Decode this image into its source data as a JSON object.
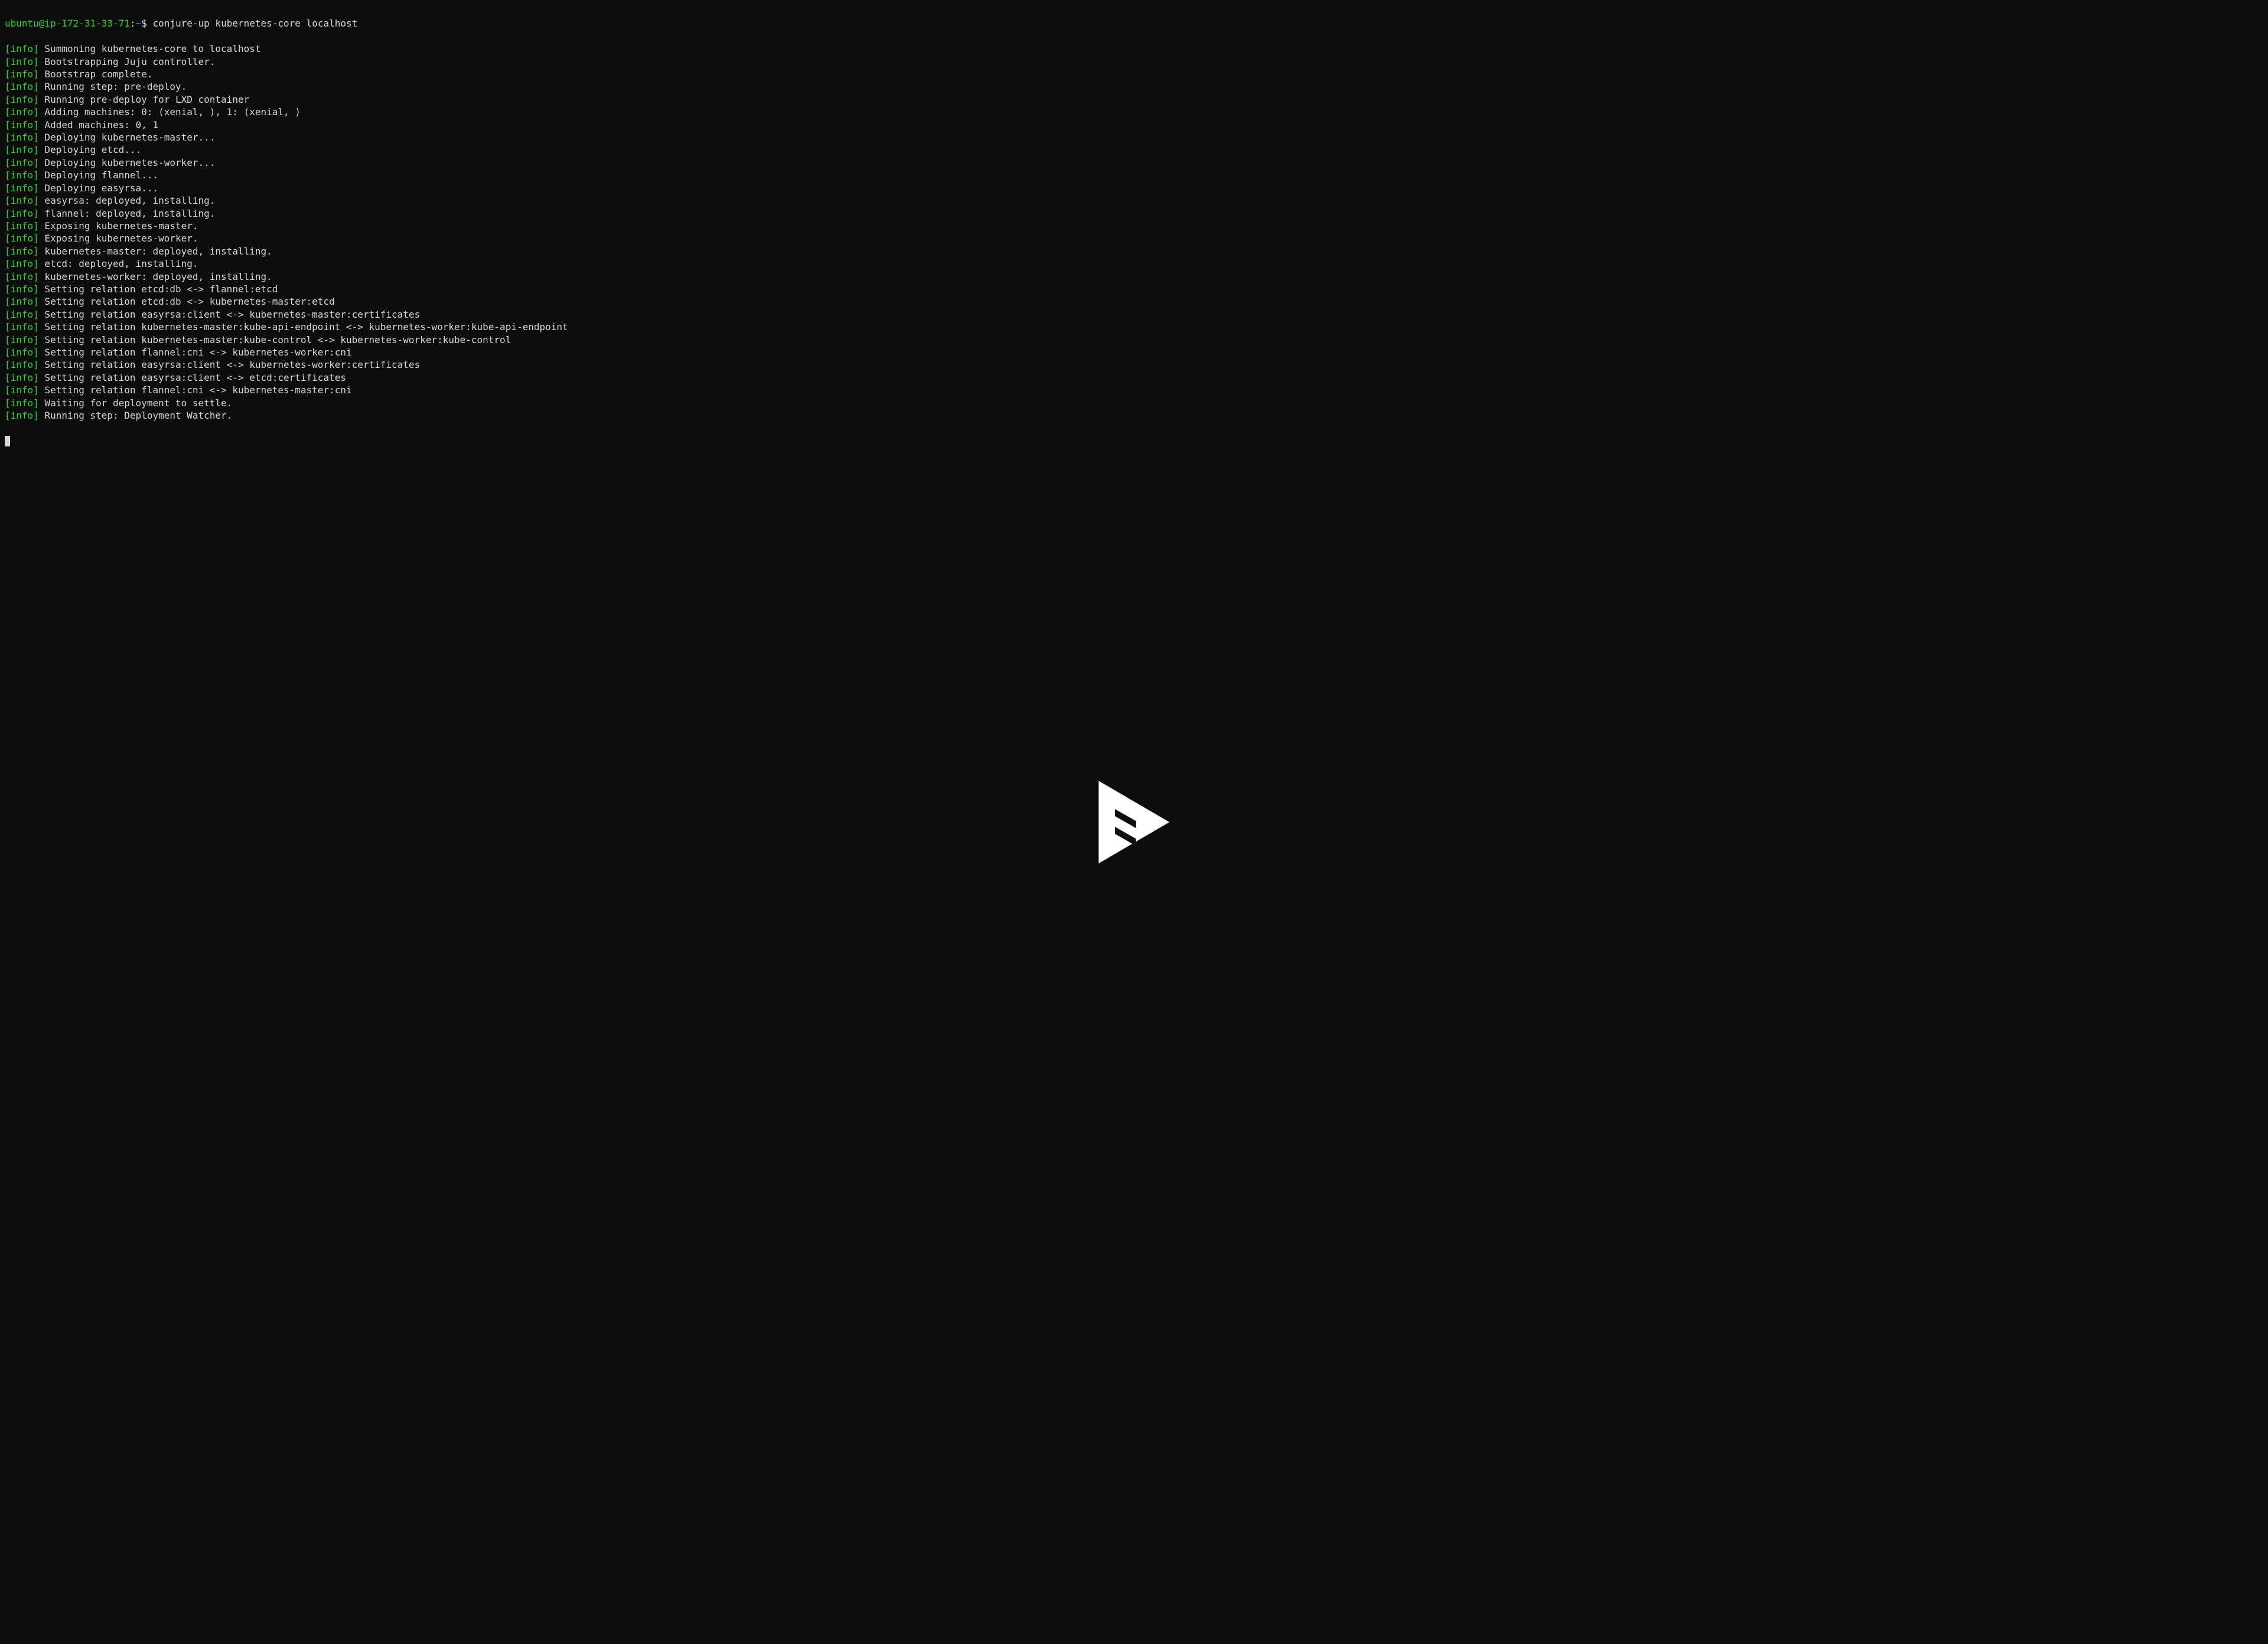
{
  "prompt": {
    "user_host": "ubuntu@ip-172-31-33-71",
    "colon": ":",
    "cwd": "~",
    "dollar": "$ ",
    "command": "conjure-up kubernetes-core localhost"
  },
  "tag": "[info]",
  "lines": [
    "Summoning kubernetes-core to localhost",
    "Bootstrapping Juju controller.",
    "Bootstrap complete.",
    "Running step: pre-deploy.",
    "Running pre-deploy for LXD container",
    "Adding machines: 0: (xenial, ), 1: (xenial, )",
    "Added machines: 0, 1",
    "Deploying kubernetes-master...",
    "Deploying etcd...",
    "Deploying kubernetes-worker...",
    "Deploying flannel...",
    "Deploying easyrsa...",
    "easyrsa: deployed, installing.",
    "flannel: deployed, installing.",
    "Exposing kubernetes-master.",
    "Exposing kubernetes-worker.",
    "kubernetes-master: deployed, installing.",
    "etcd: deployed, installing.",
    "kubernetes-worker: deployed, installing.",
    "Setting relation etcd:db <-> flannel:etcd",
    "Setting relation etcd:db <-> kubernetes-master:etcd",
    "Setting relation easyrsa:client <-> kubernetes-master:certificates",
    "Setting relation kubernetes-master:kube-api-endpoint <-> kubernetes-worker:kube-api-endpoint",
    "Setting relation kubernetes-master:kube-control <-> kubernetes-worker:kube-control",
    "Setting relation flannel:cni <-> kubernetes-worker:cni",
    "Setting relation easyrsa:client <-> kubernetes-worker:certificates",
    "Setting relation easyrsa:client <-> etcd:certificates",
    "Setting relation flannel:cni <-> kubernetes-master:cni",
    "Waiting for deployment to settle.",
    "Running step: Deployment Watcher."
  ],
  "icons": {
    "play": "play-icon"
  }
}
